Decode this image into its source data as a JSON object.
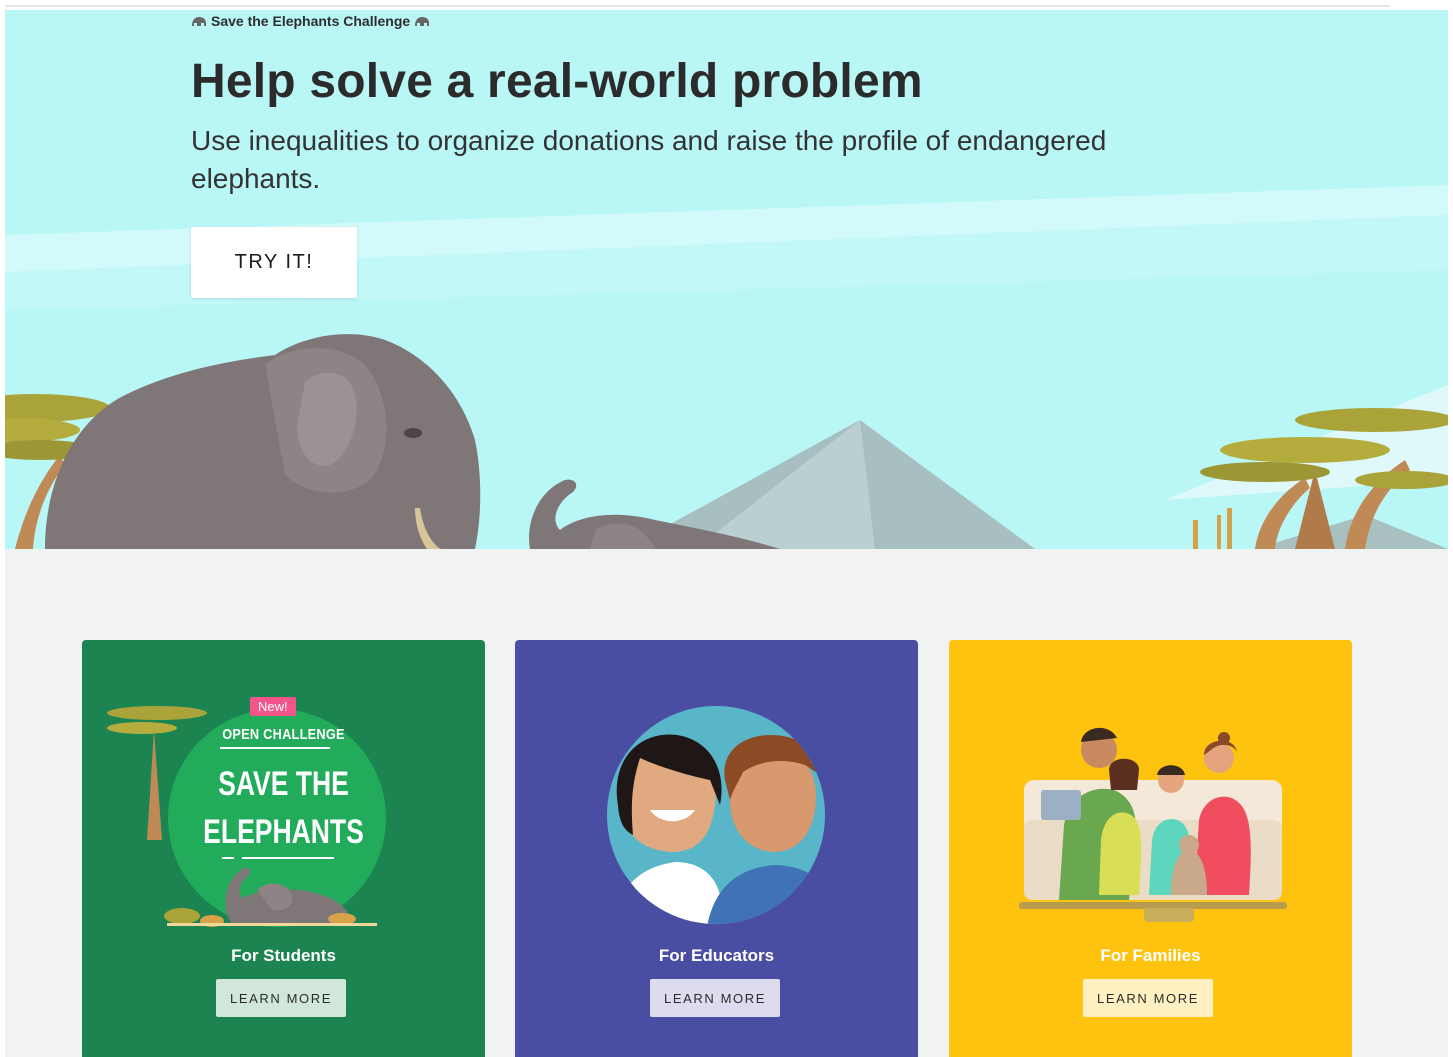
{
  "hero": {
    "eyebrow": "Save the Elephants Challenge",
    "eyebrow_icon": "elephant-icon",
    "headline": "Help solve a real-world problem",
    "subhead": "Use inequalities to organize donations and raise the profile of endangered elephants.",
    "cta_label": "TRY IT!"
  },
  "colors": {
    "hero_sky": "#b9f6f6",
    "page_bg": "#f1f3f2",
    "students_card": "#1b8450",
    "educators_card": "#4a4ea3",
    "families_card": "#fec30f",
    "badge": "#f5548a"
  },
  "cards": [
    {
      "id": "students",
      "badge": "New!",
      "art_heading": "OPEN CHALLENGE",
      "art_title": "SAVE THE\nELEPHANTS",
      "title": "For Students",
      "button": "LEARN MORE"
    },
    {
      "id": "educators",
      "title": "For Educators",
      "button": "LEARN MORE"
    },
    {
      "id": "families",
      "title": "For Families",
      "button": "LEARN MORE"
    }
  ]
}
